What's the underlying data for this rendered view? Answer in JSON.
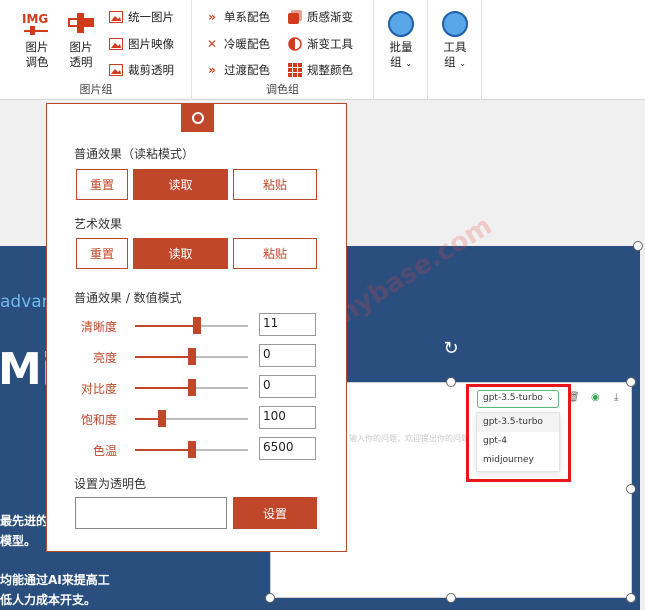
{
  "ribbon": {
    "image_group": {
      "label": "图片组",
      "img_icon_text": "IMG",
      "big_buttons": [
        {
          "line1": "图片",
          "line2": "调色"
        },
        {
          "line1": "图片",
          "line2": "透明"
        }
      ],
      "small_buttons": [
        "统一图片",
        "图片映像",
        "裁剪透明"
      ]
    },
    "color_group": {
      "label": "调色组",
      "small_buttons": [
        "单系配色",
        "冷暖配色",
        "过渡配色",
        "质感渐变",
        "渐变工具",
        "规整颜色"
      ]
    },
    "batch_group": {
      "line1": "批量",
      "line2": "组"
    },
    "tool_group": {
      "line1": "工具",
      "line2": "组"
    }
  },
  "slide": {
    "text_partial": "advar",
    "title_partial": "Mi",
    "lines": [
      "最先进的",
      "模型。",
      "均能通过AI来提高工",
      "低人力成本开支。"
    ],
    "watermark": "公众号：黑科技 hybase.com"
  },
  "screenshot": {
    "placeholder": "输入你的问题，欢迎提出你的问题",
    "selected_model": "gpt-3.5-turbo",
    "models": [
      "gpt-3.5-turbo",
      "gpt-4",
      "midjourney"
    ]
  },
  "panel": {
    "section1": "普通效果（读粘模式）",
    "section2": "艺术效果",
    "section3": "普通效果 / 数值模式",
    "section4": "设置为透明色",
    "reset": "重置",
    "read": "读取",
    "paste": "粘贴",
    "set": "设置",
    "transparent_value": "",
    "sliders": [
      {
        "label": "清晰度",
        "value": "11",
        "level": 0.55
      },
      {
        "label": "亮度",
        "value": "0",
        "level": 0.5
      },
      {
        "label": "对比度",
        "value": "0",
        "level": 0.5
      },
      {
        "label": "饱和度",
        "value": "100",
        "level": 0.24
      },
      {
        "label": "色温",
        "value": "6500",
        "level": 0.5
      }
    ]
  },
  "colors": {
    "accent": "#c0472a",
    "slide_bg": "#2a4f7f",
    "highlight": "#e8161b"
  }
}
